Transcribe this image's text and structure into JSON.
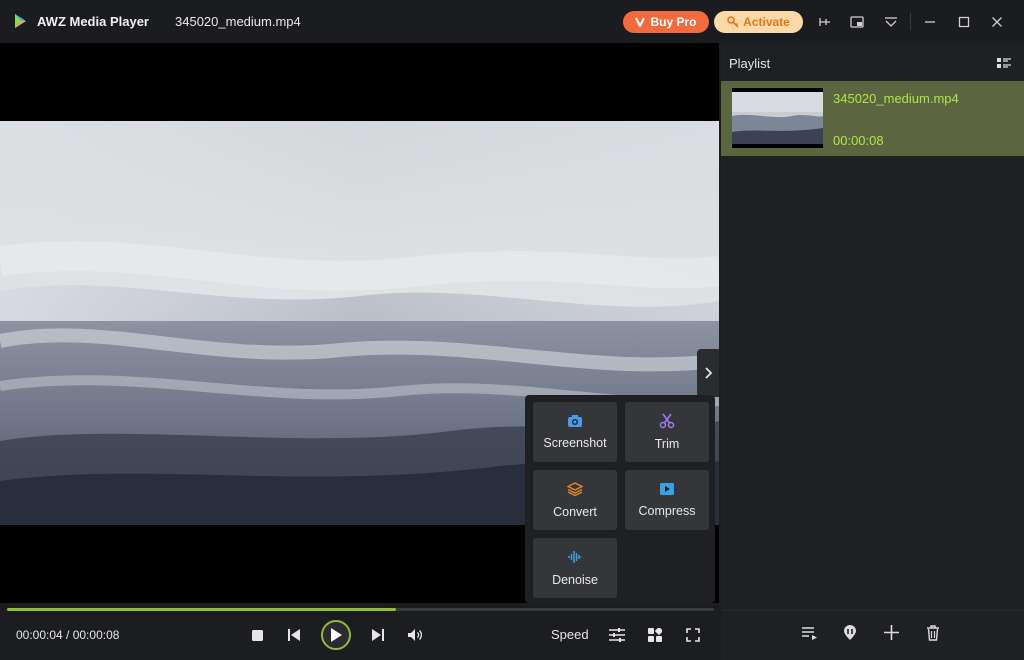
{
  "app": {
    "title": "AWZ Media Player",
    "file_name": "345020_medium.mp4"
  },
  "header": {
    "buy_pro_label": "Buy Pro",
    "activate_label": "Activate",
    "icons": [
      "pin-icon",
      "mini-mode-icon",
      "dropdown-menu-icon",
      "minimize-icon",
      "maximize-icon",
      "close-icon"
    ]
  },
  "tools": {
    "screenshot": "Screenshot",
    "trim": "Trim",
    "convert": "Convert",
    "compress": "Compress",
    "denoise": "Denoise"
  },
  "player": {
    "time": "00:00:04 / 00:00:08",
    "progress": 0.55,
    "speed_label": "Speed"
  },
  "playlist": {
    "title": "Playlist",
    "items": [
      {
        "name": "345020_medium.mp4",
        "duration": "00:00:08"
      }
    ]
  },
  "colors": {
    "accent": "#8fbd3a",
    "buy_pro": "#f26a3d",
    "activate_bg": "#fcd9a8",
    "activate_text": "#e0781b",
    "playlist_selected": "#5b6640"
  }
}
